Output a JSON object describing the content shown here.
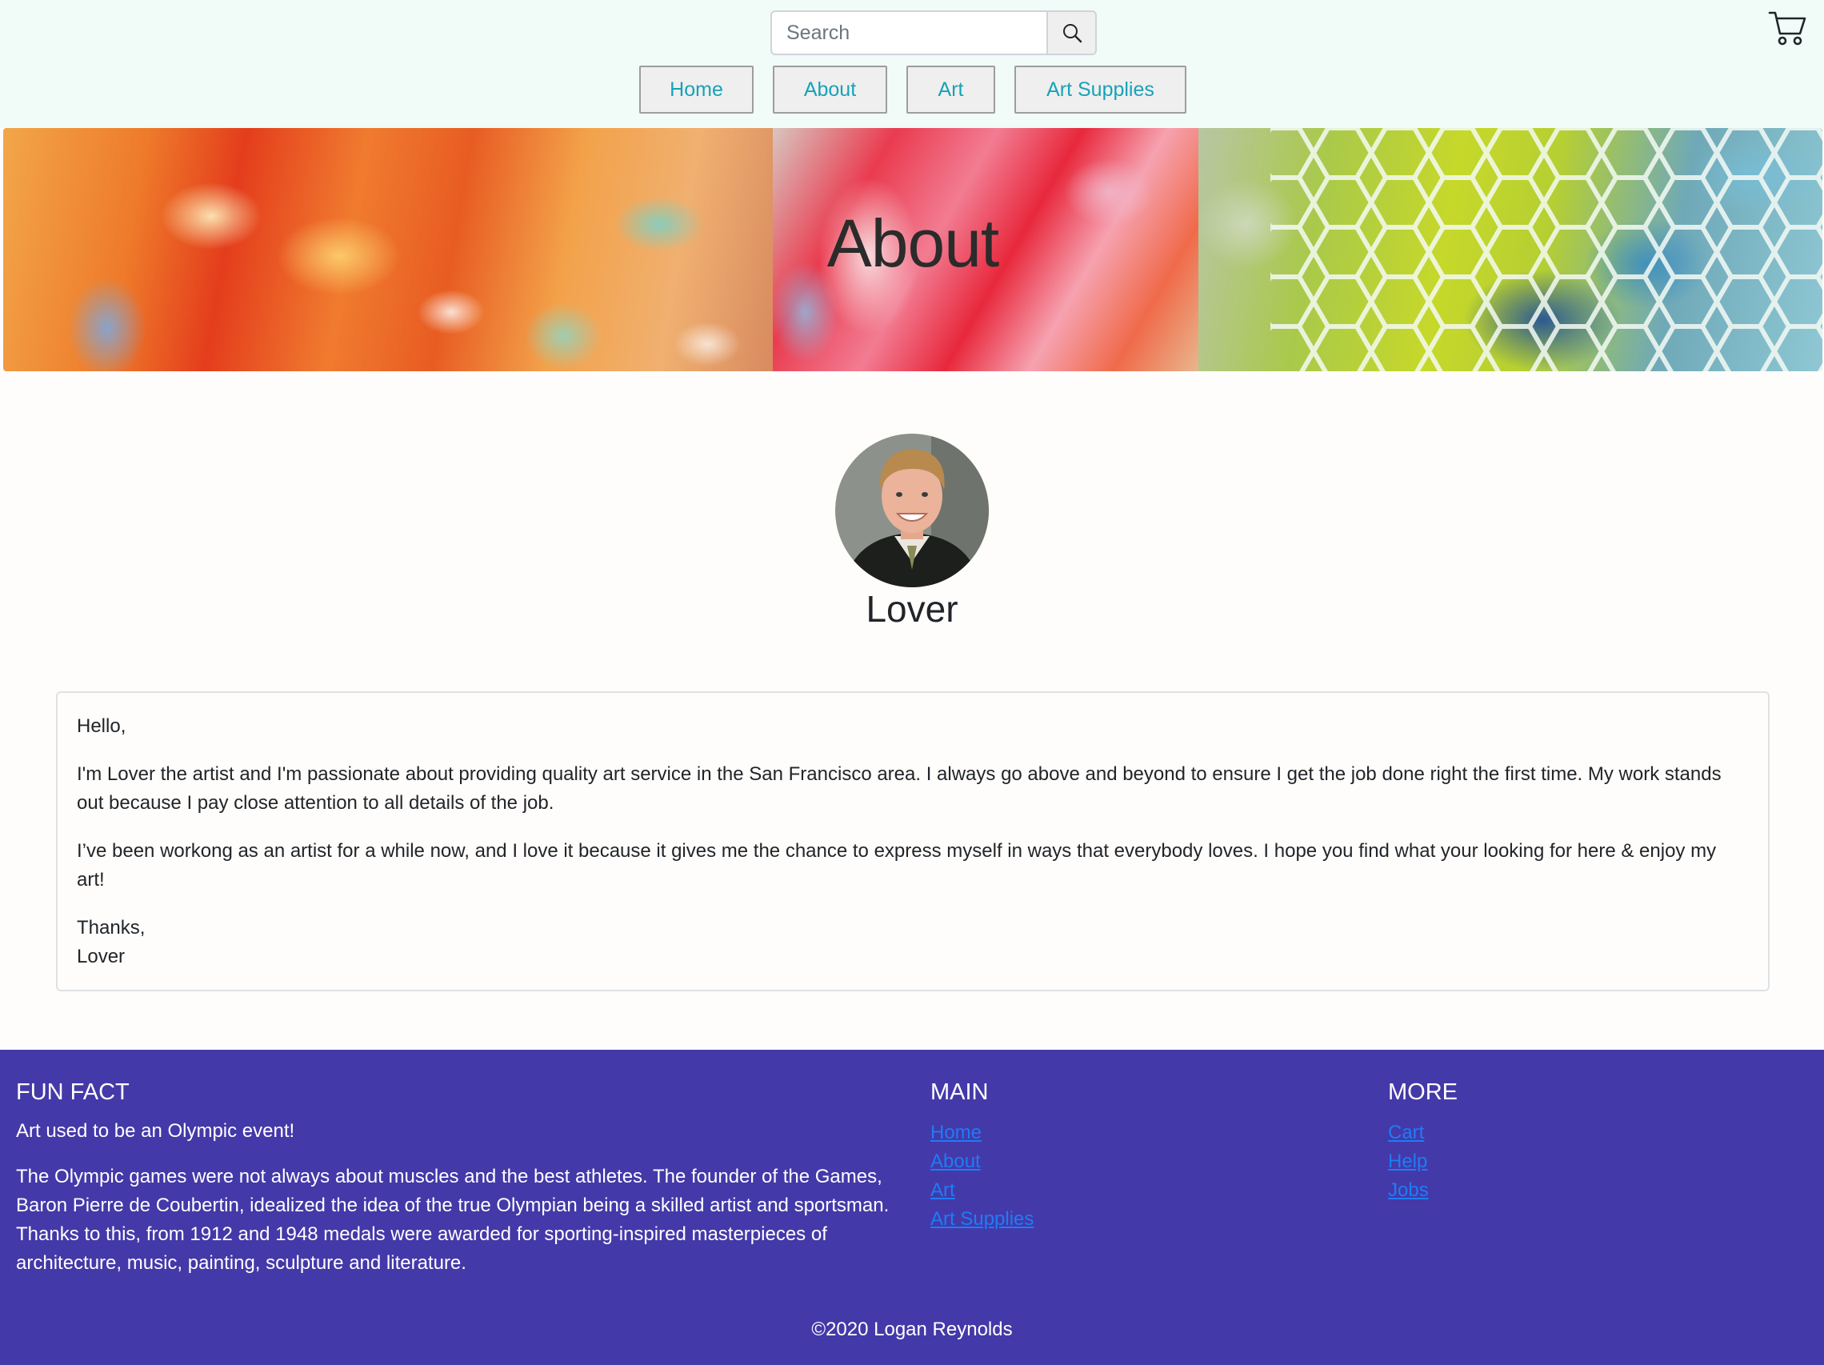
{
  "header": {
    "search_placeholder": "Search",
    "nav": [
      {
        "label": "Home"
      },
      {
        "label": "About"
      },
      {
        "label": "Art"
      },
      {
        "label": "Art Supplies"
      }
    ]
  },
  "hero": {
    "title": "About"
  },
  "profile": {
    "name": "Lover"
  },
  "bio": {
    "greeting": "Hello,",
    "paragraph1": "I'm Lover the artist and I'm passionate about providing quality art service in the San Francisco area. I always go above and beyond to ensure I get the job done right the first time. My work stands out because I pay close attention to all details of the job.",
    "paragraph2": "I’ve been workong as an artist for a while now, and I love it because it gives me the chance to express myself in ways that everybody loves. I hope you find what your looking for here & enjoy my art!",
    "signoff": "Thanks,",
    "signature": "Lover"
  },
  "footer": {
    "fun_fact": {
      "heading": "FUN FACT",
      "headline": "Art used to be an Olympic event!",
      "body": "The Olympic games were not always about muscles and the best athletes. The founder of the Games, Baron Pierre de Coubertin, idealized the idea of the true Olympian being a skilled artist and sportsman. Thanks to this, from 1912 and 1948 medals were awarded for sporting-inspired masterpieces of architecture, music, painting, sculpture and literature."
    },
    "main": {
      "heading": "MAIN",
      "links": [
        "Home",
        "About",
        "Art",
        "Art Supplies"
      ]
    },
    "more": {
      "heading": "MORE",
      "links": [
        "Cart",
        "Help",
        "Jobs"
      ]
    },
    "copyright": "©2020 Logan Reynolds"
  },
  "colors": {
    "header_bg": "#f1fcf8",
    "nav_text": "#17a2b8",
    "footer_bg": "#4439a8",
    "footer_link": "#1e7cf6",
    "page_bg": "#fffdfb"
  },
  "icons": {
    "search": "search-icon",
    "cart": "cart-icon"
  }
}
